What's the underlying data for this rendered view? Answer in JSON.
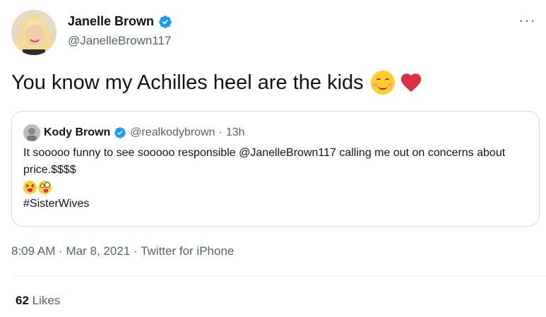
{
  "author": {
    "name": "Janelle Brown",
    "handle": "@JanelleBrown117",
    "verified_color": "#1d9bf0"
  },
  "tweet": {
    "text": "You know my Achilles heel are the kids",
    "emojis": [
      "smiling-face-with-blush",
      "red-heart"
    ]
  },
  "quoted_tweet": {
    "name": "Kody Brown",
    "handle": "@realkodybrown",
    "separator": "·",
    "time": "13h",
    "text": "It sooooo funny to see sooooo responsible @JanelleBrown117 calling me out on concerns about price.$$$$",
    "emojis": [
      "squinting-face-with-tongue",
      "zany-face"
    ],
    "hashtag": "#SisterWives"
  },
  "meta": {
    "time": "8:09 AM",
    "separator1": "·",
    "date": "Mar 8, 2021",
    "separator2": "·",
    "source": "Twitter for iPhone"
  },
  "stats": {
    "likes_count": "62",
    "likes_label": "Likes"
  },
  "more_label": "···",
  "colors": {
    "text": "#0f1419",
    "secondary": "#536471",
    "border": "#cfd9de",
    "heart": "#e0245e"
  }
}
